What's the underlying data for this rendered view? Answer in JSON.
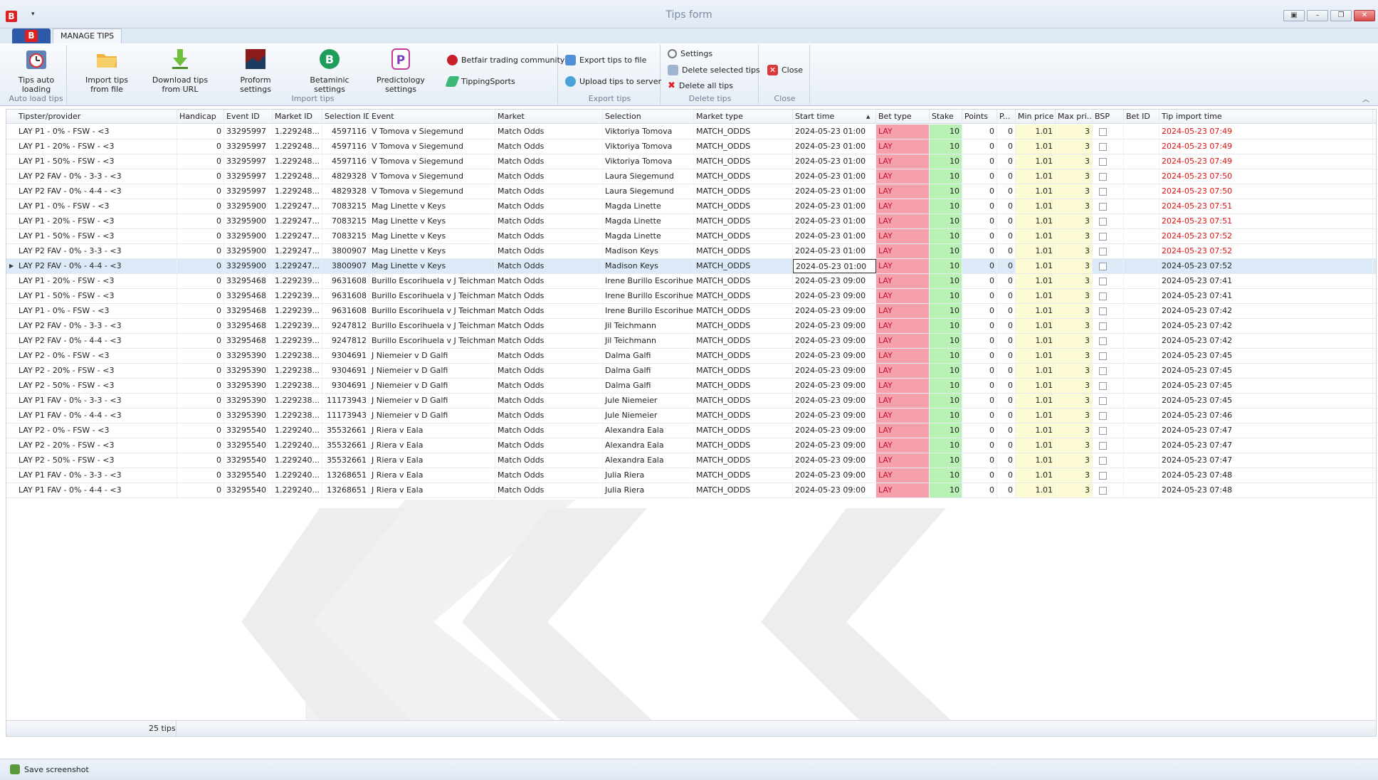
{
  "window": {
    "title": "Tips form",
    "logo": "B"
  },
  "ribbon_tab": "MANAGE TIPS",
  "ribbon": {
    "groups": [
      {
        "label": "Auto load tips"
      },
      {
        "label": "Import tips"
      },
      {
        "label": "Export tips"
      },
      {
        "label": "Delete tips"
      },
      {
        "label": "Close"
      }
    ],
    "buttons": {
      "tips_auto_loading": [
        "Tips auto",
        "loading"
      ],
      "import_from_file": [
        "Import tips",
        "from file"
      ],
      "download_from_url": [
        "Download tips",
        "from URL"
      ],
      "proform_settings": [
        "Proform settings",
        ""
      ],
      "betaminic_settings": [
        "Betaminic settings",
        ""
      ],
      "predictology_settings": [
        "Predictology",
        "settings"
      ],
      "betfair_community": "Betfair trading community",
      "tipping_sports": "TippingSports",
      "export_to_file": "Export tips to file",
      "upload_to_server": "Upload tips to server",
      "settings": "Settings",
      "delete_selected": "Delete selected tips",
      "delete_all": "Delete all tips",
      "close": "Close"
    }
  },
  "colors": {
    "bet_type_bg": "#f5a0ab",
    "stake_bg": "#b9f0b4",
    "price_bg": "#fdfbd3",
    "late_import": "#e01010",
    "selected_row": "#dceaf7"
  },
  "columns": [
    "Tipster/provider",
    "Handicap",
    "Event ID",
    "Market ID",
    "Selection ID",
    "Event",
    "Market",
    "Selection",
    "Market type",
    "Start time",
    "Bet type",
    "Stake",
    "Points",
    "P...",
    "Min price",
    "Max pri...",
    "BSP",
    "Bet ID",
    "Tip import time"
  ],
  "rows": [
    [
      "LAY P1 - 0% - FSW - <3",
      "0",
      "33295997",
      "1.229248...",
      "4597116",
      "V Tomova v Siegemund",
      "Match Odds",
      "Viktoriya Tomova",
      "MATCH_ODDS",
      "2024-05-23 01:00",
      "LAY",
      "10",
      "0",
      "0",
      "1.01",
      "3",
      "",
      "",
      "2024-05-23 07:49",
      true
    ],
    [
      "LAY P1 - 20% - FSW - <3",
      "0",
      "33295997",
      "1.229248...",
      "4597116",
      "V Tomova v Siegemund",
      "Match Odds",
      "Viktoriya Tomova",
      "MATCH_ODDS",
      "2024-05-23 01:00",
      "LAY",
      "10",
      "0",
      "0",
      "1.01",
      "3",
      "",
      "",
      "2024-05-23 07:49",
      true
    ],
    [
      "LAY P1 - 50% - FSW - <3",
      "0",
      "33295997",
      "1.229248...",
      "4597116",
      "V Tomova v Siegemund",
      "Match Odds",
      "Viktoriya Tomova",
      "MATCH_ODDS",
      "2024-05-23 01:00",
      "LAY",
      "10",
      "0",
      "0",
      "1.01",
      "3",
      "",
      "",
      "2024-05-23 07:49",
      true
    ],
    [
      "LAY P2 FAV - 0% - 3-3 - <3",
      "0",
      "33295997",
      "1.229248...",
      "4829328",
      "V Tomova v Siegemund",
      "Match Odds",
      "Laura Siegemund",
      "MATCH_ODDS",
      "2024-05-23 01:00",
      "LAY",
      "10",
      "0",
      "0",
      "1.01",
      "3",
      "",
      "",
      "2024-05-23 07:50",
      true
    ],
    [
      "LAY P2 FAV - 0% - 4-4 - <3",
      "0",
      "33295997",
      "1.229248...",
      "4829328",
      "V Tomova v Siegemund",
      "Match Odds",
      "Laura Siegemund",
      "MATCH_ODDS",
      "2024-05-23 01:00",
      "LAY",
      "10",
      "0",
      "0",
      "1.01",
      "3",
      "",
      "",
      "2024-05-23 07:50",
      true
    ],
    [
      "LAY P1 - 0% - FSW - <3",
      "0",
      "33295900",
      "1.229247...",
      "7083215",
      "Mag Linette v Keys",
      "Match Odds",
      "Magda Linette",
      "MATCH_ODDS",
      "2024-05-23 01:00",
      "LAY",
      "10",
      "0",
      "0",
      "1.01",
      "3",
      "",
      "",
      "2024-05-23 07:51",
      true
    ],
    [
      "LAY P1 - 20% - FSW - <3",
      "0",
      "33295900",
      "1.229247...",
      "7083215",
      "Mag Linette v Keys",
      "Match Odds",
      "Magda Linette",
      "MATCH_ODDS",
      "2024-05-23 01:00",
      "LAY",
      "10",
      "0",
      "0",
      "1.01",
      "3",
      "",
      "",
      "2024-05-23 07:51",
      true
    ],
    [
      "LAY P1 - 50% - FSW - <3",
      "0",
      "33295900",
      "1.229247...",
      "7083215",
      "Mag Linette v Keys",
      "Match Odds",
      "Magda Linette",
      "MATCH_ODDS",
      "2024-05-23 01:00",
      "LAY",
      "10",
      "0",
      "0",
      "1.01",
      "3",
      "",
      "",
      "2024-05-23 07:52",
      true
    ],
    [
      "LAY P2 FAV - 0% - 3-3 - <3",
      "0",
      "33295900",
      "1.229247...",
      "3800907",
      "Mag Linette v Keys",
      "Match Odds",
      "Madison Keys",
      "MATCH_ODDS",
      "2024-05-23 01:00",
      "LAY",
      "10",
      "0",
      "0",
      "1.01",
      "3",
      "",
      "",
      "2024-05-23 07:52",
      true
    ],
    [
      "LAY P2 FAV - 0% - 4-4 - <3",
      "0",
      "33295900",
      "1.229247...",
      "3800907",
      "Mag Linette v Keys",
      "Match Odds",
      "Madison Keys",
      "MATCH_ODDS",
      "2024-05-23 01:00",
      "LAY",
      "10",
      "0",
      "0",
      "1.01",
      "3",
      "",
      "",
      "2024-05-23 07:52",
      false
    ],
    [
      "LAY P1 - 20% - FSW - <3",
      "0",
      "33295468",
      "1.229239...",
      "9631608",
      "Burillo Escorihuela v J Teichmann",
      "Match Odds",
      "Irene Burillo Escorihue",
      "MATCH_ODDS",
      "2024-05-23 09:00",
      "LAY",
      "10",
      "0",
      "0",
      "1.01",
      "3",
      "",
      "",
      "2024-05-23 07:41",
      false
    ],
    [
      "LAY P1 - 50% - FSW - <3",
      "0",
      "33295468",
      "1.229239...",
      "9631608",
      "Burillo Escorihuela v J Teichmann",
      "Match Odds",
      "Irene Burillo Escorihue",
      "MATCH_ODDS",
      "2024-05-23 09:00",
      "LAY",
      "10",
      "0",
      "0",
      "1.01",
      "3",
      "",
      "",
      "2024-05-23 07:41",
      false
    ],
    [
      "LAY P1 - 0% - FSW - <3",
      "0",
      "33295468",
      "1.229239...",
      "9631608",
      "Burillo Escorihuela v J Teichmann",
      "Match Odds",
      "Irene Burillo Escorihue",
      "MATCH_ODDS",
      "2024-05-23 09:00",
      "LAY",
      "10",
      "0",
      "0",
      "1.01",
      "3",
      "",
      "",
      "2024-05-23 07:42",
      false
    ],
    [
      "LAY P2 FAV - 0% - 3-3 - <3",
      "0",
      "33295468",
      "1.229239...",
      "9247812",
      "Burillo Escorihuela v J Teichmann",
      "Match Odds",
      "Jil Teichmann",
      "MATCH_ODDS",
      "2024-05-23 09:00",
      "LAY",
      "10",
      "0",
      "0",
      "1.01",
      "3",
      "",
      "",
      "2024-05-23 07:42",
      false
    ],
    [
      "LAY P2 FAV - 0% - 4-4 - <3",
      "0",
      "33295468",
      "1.229239...",
      "9247812",
      "Burillo Escorihuela v J Teichmann",
      "Match Odds",
      "Jil Teichmann",
      "MATCH_ODDS",
      "2024-05-23 09:00",
      "LAY",
      "10",
      "0",
      "0",
      "1.01",
      "3",
      "",
      "",
      "2024-05-23 07:42",
      false
    ],
    [
      "LAY P2 - 0% - FSW - <3",
      "0",
      "33295390",
      "1.229238...",
      "9304691",
      "J Niemeier v D Galfi",
      "Match Odds",
      "Dalma Galfi",
      "MATCH_ODDS",
      "2024-05-23 09:00",
      "LAY",
      "10",
      "0",
      "0",
      "1.01",
      "3",
      "",
      "",
      "2024-05-23 07:45",
      false
    ],
    [
      "LAY P2 - 20% - FSW - <3",
      "0",
      "33295390",
      "1.229238...",
      "9304691",
      "J Niemeier v D Galfi",
      "Match Odds",
      "Dalma Galfi",
      "MATCH_ODDS",
      "2024-05-23 09:00",
      "LAY",
      "10",
      "0",
      "0",
      "1.01",
      "3",
      "",
      "",
      "2024-05-23 07:45",
      false
    ],
    [
      "LAY P2 - 50% - FSW - <3",
      "0",
      "33295390",
      "1.229238...",
      "9304691",
      "J Niemeier v D Galfi",
      "Match Odds",
      "Dalma Galfi",
      "MATCH_ODDS",
      "2024-05-23 09:00",
      "LAY",
      "10",
      "0",
      "0",
      "1.01",
      "3",
      "",
      "",
      "2024-05-23 07:45",
      false
    ],
    [
      "LAY P1 FAV - 0% - 3-3 - <3",
      "0",
      "33295390",
      "1.229238...",
      "11173943",
      "J Niemeier v D Galfi",
      "Match Odds",
      "Jule Niemeier",
      "MATCH_ODDS",
      "2024-05-23 09:00",
      "LAY",
      "10",
      "0",
      "0",
      "1.01",
      "3",
      "",
      "",
      "2024-05-23 07:45",
      false
    ],
    [
      "LAY P1 FAV - 0% - 4-4 - <3",
      "0",
      "33295390",
      "1.229238...",
      "11173943",
      "J Niemeier v D Galfi",
      "Match Odds",
      "Jule Niemeier",
      "MATCH_ODDS",
      "2024-05-23 09:00",
      "LAY",
      "10",
      "0",
      "0",
      "1.01",
      "3",
      "",
      "",
      "2024-05-23 07:46",
      false
    ],
    [
      "LAY P2 - 0% - FSW - <3",
      "0",
      "33295540",
      "1.229240...",
      "35532661",
      "J Riera v Eala",
      "Match Odds",
      "Alexandra Eala",
      "MATCH_ODDS",
      "2024-05-23 09:00",
      "LAY",
      "10",
      "0",
      "0",
      "1.01",
      "3",
      "",
      "",
      "2024-05-23 07:47",
      false
    ],
    [
      "LAY P2 - 20% - FSW - <3",
      "0",
      "33295540",
      "1.229240...",
      "35532661",
      "J Riera v Eala",
      "Match Odds",
      "Alexandra Eala",
      "MATCH_ODDS",
      "2024-05-23 09:00",
      "LAY",
      "10",
      "0",
      "0",
      "1.01",
      "3",
      "",
      "",
      "2024-05-23 07:47",
      false
    ],
    [
      "LAY P2 - 50% - FSW - <3",
      "0",
      "33295540",
      "1.229240...",
      "35532661",
      "J Riera v Eala",
      "Match Odds",
      "Alexandra Eala",
      "MATCH_ODDS",
      "2024-05-23 09:00",
      "LAY",
      "10",
      "0",
      "0",
      "1.01",
      "3",
      "",
      "",
      "2024-05-23 07:47",
      false
    ],
    [
      "LAY P1 FAV - 0% - 3-3 - <3",
      "0",
      "33295540",
      "1.229240...",
      "13268651",
      "J Riera v Eala",
      "Match Odds",
      "Julia Riera",
      "MATCH_ODDS",
      "2024-05-23 09:00",
      "LAY",
      "10",
      "0",
      "0",
      "1.01",
      "3",
      "",
      "",
      "2024-05-23 07:48",
      false
    ],
    [
      "LAY P1 FAV - 0% - 4-4 - <3",
      "0",
      "33295540",
      "1.229240...",
      "13268651",
      "J Riera v Eala",
      "Match Odds",
      "Julia Riera",
      "MATCH_ODDS",
      "2024-05-23 09:00",
      "LAY",
      "10",
      "0",
      "0",
      "1.01",
      "3",
      "",
      "",
      "2024-05-23 07:48",
      false
    ]
  ],
  "selected_row": 9,
  "footer": {
    "count": "25 tips"
  },
  "status": {
    "save_screenshot": "Save screenshot"
  }
}
